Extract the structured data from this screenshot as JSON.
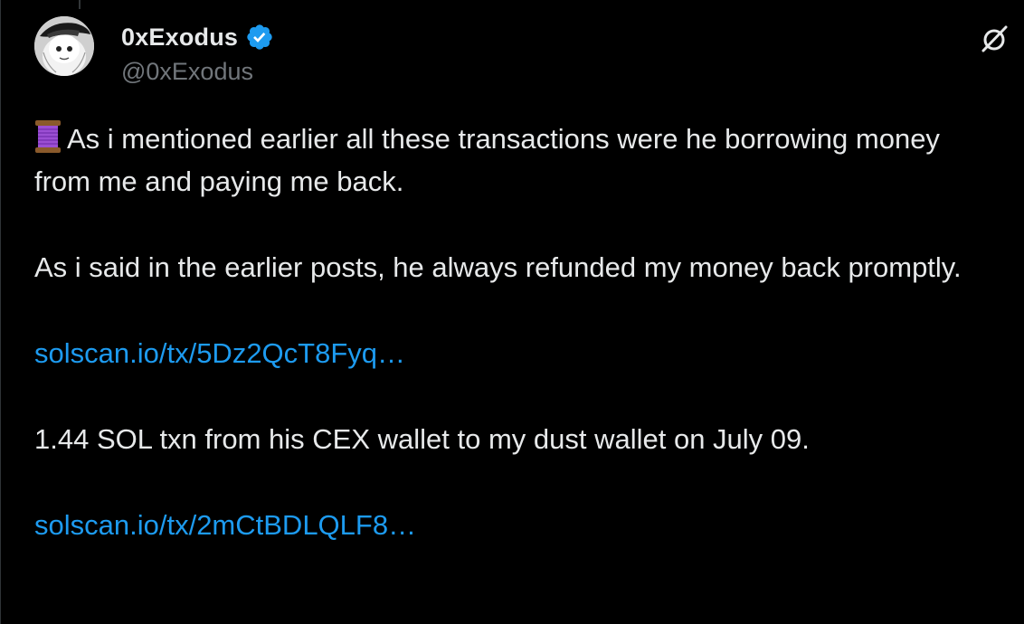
{
  "author": {
    "display_name": "0xExodus",
    "handle": "@0xExodus",
    "verified": true,
    "verified_color": "#1d9bf0"
  },
  "icons": {
    "spool": "thread-spool-icon",
    "grok": "grok-slash-icon",
    "verified": "verified-badge-icon"
  },
  "tweet": {
    "paragraph1_text": "As i mentioned earlier all these transactions were he borrowing money from me and paying me back.",
    "paragraph2_text": "As i said in the earlier posts, he always refunded my money back promptly.",
    "link1": "solscan.io/tx/5Dz2QcT8Fyq…",
    "paragraph3_text": "1.44 SOL txn from his CEX wallet to my dust wallet on July 09.",
    "link2": "solscan.io/tx/2mCtBDLQLF8…"
  },
  "colors": {
    "background": "#000000",
    "text": "#e7e9ea",
    "secondary_text": "#71767b",
    "link": "#1d9bf0"
  }
}
